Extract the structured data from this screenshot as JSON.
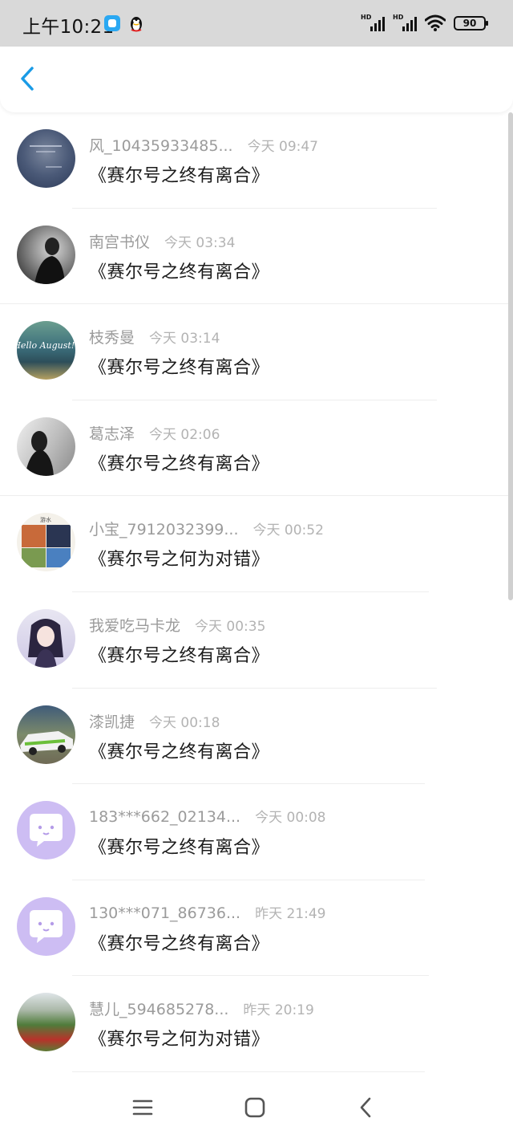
{
  "status_bar": {
    "time": "上午10:21",
    "signal1_label": "HD",
    "signal2_label": "HD",
    "battery": "90"
  },
  "header": {
    "back_icon": "chevron-left-icon",
    "accent_color": "#1a9be6"
  },
  "items": [
    {
      "name": "风_10435933485...",
      "time": "今天 09:47",
      "title": "《赛尔号之终有离合》"
    },
    {
      "name": "南宫书仪",
      "time": "今天 03:34",
      "title": "《赛尔号之终有离合》"
    },
    {
      "name": "枝秀曼",
      "time": "今天 03:14",
      "title": "《赛尔号之终有离合》",
      "avatar_text": "Hello August!!"
    },
    {
      "name": "葛志泽",
      "time": "今天 02:06",
      "title": "《赛尔号之终有离合》"
    },
    {
      "name": "小宝_7912032399...",
      "time": "今天 00:52",
      "title": "《赛尔号之何为对错》",
      "avatar_text": "游水"
    },
    {
      "name": "我爱吃马卡龙",
      "time": "今天 00:35",
      "title": "《赛尔号之终有离合》"
    },
    {
      "name": "漆凯捷",
      "time": "今天 00:18",
      "title": "《赛尔号之终有离合》"
    },
    {
      "name": "183***662_02134...",
      "time": "今天 00:08",
      "title": "《赛尔号之终有离合》"
    },
    {
      "name": "130***071_86736...",
      "time": "昨天 21:49",
      "title": "《赛尔号之终有离合》"
    },
    {
      "name": "慧儿_594685278...",
      "time": "昨天 20:19",
      "title": "《赛尔号之何为对错》"
    }
  ],
  "nav": {
    "menu_icon": "menu-icon",
    "home_icon": "home-square-icon",
    "back_icon": "back-triangle-icon"
  }
}
